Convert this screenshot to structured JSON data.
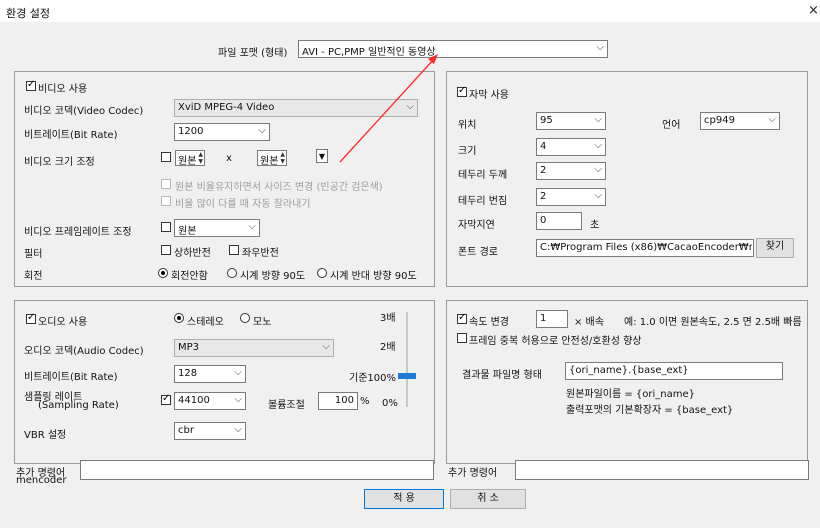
{
  "window": {
    "title": "환경 설정",
    "close": "×"
  },
  "format": {
    "label": "파일 포맷 (형태)",
    "value": "AVI - PC,PMP 일반적인 동영상"
  },
  "video": {
    "enable_label": "비디오 사용",
    "codec_label": "비디오 코덱(Video Codec)",
    "codec_value": "XviD MPEG-4 Video",
    "bitrate_label": "비트레이트(Bit Rate)",
    "bitrate_value": "1200",
    "size_label": "비디오 크기 조정",
    "width_value": "원본",
    "times": "x",
    "height_value": "원본",
    "keep_ratio_label": "원본 비율유지하면서 사이즈 변경 (빈공간 검은색)",
    "crop_label": "비율 많이 다를 때 자동 잘라내기",
    "framerate_label": "비디오 프레임레이트 조정",
    "framerate_value": "원본",
    "filter_label": "필터",
    "flip_v_label": "상하반전",
    "flip_h_label": "좌우반전",
    "rotate_label": "회전",
    "rotate_options": [
      "회전안함",
      "시계 방향 90도",
      "시계 반대 방향 90도"
    ]
  },
  "subtitle": {
    "enable_label": "자막 사용",
    "position_label": "위치",
    "position_value": "95",
    "lang_label": "언어",
    "lang_value": "cp949",
    "size_label": "크기",
    "size_value": "4",
    "border_label": "테두리 두께",
    "border_value": "2",
    "blur_label": "테두리 번짐",
    "blur_value": "2",
    "delay_label": "자막지연",
    "delay_value": "0",
    "delay_unit": "초",
    "font_label": "폰트 경로",
    "font_value": "C:₩Program Files (x86)₩CacaoEncoder₩m",
    "browse_label": "찾기"
  },
  "audio": {
    "enable_label": "오디오 사용",
    "stereo_label": "스테레오",
    "mono_label": "모노",
    "codec_label": "오디오 코덱(Audio Codec)",
    "codec_value": "MP3",
    "bitrate_label": "비트레이트(Bit Rate)",
    "bitrate_value": "128",
    "sampling_label": "샘플링 레이트",
    "sampling_sub": "(Sampling Rate)",
    "sampling_value": "44100",
    "volume_label": "볼륨조절",
    "volume_value": "100",
    "volume_unit": "%",
    "vbr_label": "VBR 설정",
    "vbr_value": "cbr",
    "scale_3x": "3배",
    "scale_2x": "2배",
    "scale_base": "기준100%",
    "scale_0": "0%",
    "volume_level": 0.33,
    "slider_color": "#1e7ad6"
  },
  "speed": {
    "enable_label": "속도 변경",
    "value": "1",
    "unit": "× 배속",
    "example": "예: 1.0 이면 원본속도, 2.5 면 2.5배 빠름",
    "dup_label": "프레임 중복 허용으로 안전성/호환성 향상",
    "output_label": "결과물 파일명 형태",
    "output_value": "{ori_name}.{base_ext}",
    "hint1": "원본파일이름 = {ori_name}",
    "hint2": "출력포맷의 기본확장자 = {base_ext}"
  },
  "extra": {
    "cmd_label": "추가 명령어",
    "cmd_sub": "mencoder",
    "cmd2_label": "추가 명령어"
  },
  "buttons": {
    "apply": "적 용",
    "cancel": "취 소"
  },
  "colors": {
    "arrow": "#ff2a2a",
    "focus": "#0078d7"
  }
}
